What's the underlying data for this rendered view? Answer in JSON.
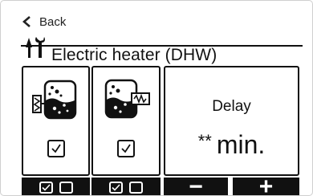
{
  "nav": {
    "back_label": "Back"
  },
  "header": {
    "title": "Electric heater (DHW)"
  },
  "panels": [
    {
      "icon": "tank-with-electric-heater-icon",
      "checkbox_checked": true,
      "bottom": {
        "checkbox1": true,
        "checkbox2": false
      }
    },
    {
      "icon": "tank-with-booster-heater-icon",
      "checkbox_checked": true,
      "bottom": {
        "checkbox1": true,
        "checkbox2": false
      }
    }
  ],
  "delay": {
    "label": "Delay",
    "value": "**",
    "unit": "min.",
    "decrease_symbol": "−",
    "increase_symbol": "+"
  },
  "colors": {
    "foreground": "#111111",
    "background": "#ffffff",
    "border": "#cfcfcf"
  }
}
